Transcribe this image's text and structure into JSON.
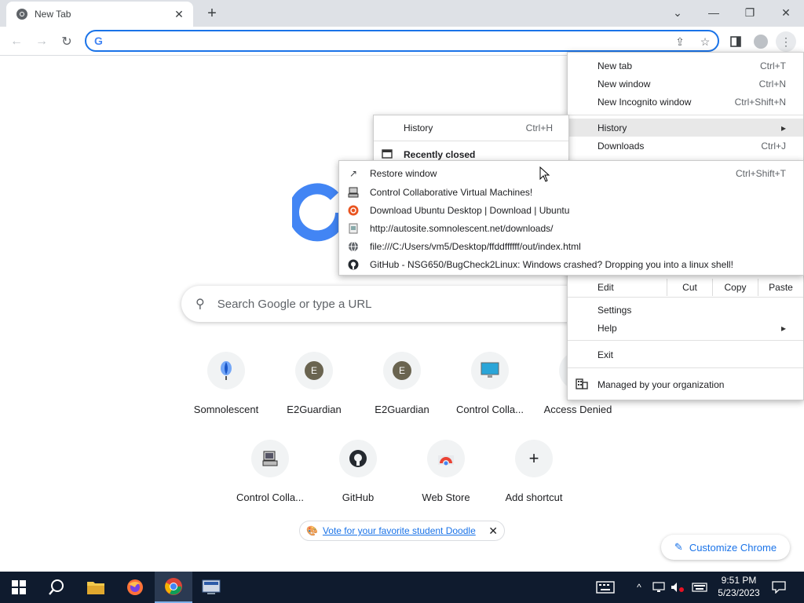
{
  "tab": {
    "title": "New Tab",
    "close": "✕",
    "new_tab": "+"
  },
  "window_controls": {
    "tab_search": "⌄",
    "minimize": "—",
    "restore": "❐",
    "close": "✕"
  },
  "toolbar": {
    "back": "←",
    "forward": "→",
    "reload": "↻",
    "omnibox_value": "",
    "omnibox_g": "G"
  },
  "search": {
    "placeholder": "Search Google or type a URL",
    "icon": "⚲"
  },
  "shortcuts_row1": [
    {
      "label": "Somnolescent",
      "icon": "balloon-icon"
    },
    {
      "label": "E2Guardian",
      "letter": "E"
    },
    {
      "label": "E2Guardian",
      "letter": "E"
    },
    {
      "label": "Control Colla...",
      "icon": "monitor-icon"
    },
    {
      "label": "Access Denied",
      "letter": ""
    }
  ],
  "shortcuts_row2": [
    {
      "label": "Control Colla...",
      "icon": "computer-icon"
    },
    {
      "label": "GitHub",
      "icon": "github-icon"
    },
    {
      "label": "Web Store",
      "icon": "webstore-icon"
    },
    {
      "label": "Add shortcut",
      "glyph": "+"
    }
  ],
  "doodle": {
    "text": "Vote for your favorite student Doodle",
    "close": "✕"
  },
  "customize": {
    "label": "Customize Chrome",
    "icon": "✎"
  },
  "menu": {
    "new_tab": {
      "label": "New tab",
      "shortcut": "Ctrl+T"
    },
    "new_window": {
      "label": "New window",
      "shortcut": "Ctrl+N"
    },
    "new_incognito": {
      "label": "New Incognito window",
      "shortcut": "Ctrl+Shift+N"
    },
    "history": {
      "label": "History",
      "arrow": "▸"
    },
    "downloads": {
      "label": "Downloads",
      "shortcut": "Ctrl+J"
    },
    "edit": {
      "label": "Edit",
      "cut": "Cut",
      "copy": "Copy",
      "paste": "Paste"
    },
    "settings": {
      "label": "Settings"
    },
    "help": {
      "label": "Help",
      "arrow": "▸"
    },
    "exit": {
      "label": "Exit"
    },
    "managed": {
      "label": "Managed by your organization"
    }
  },
  "history_submenu": {
    "history": {
      "label": "History",
      "shortcut": "Ctrl+H"
    },
    "recently_closed": {
      "label": "Recently closed"
    }
  },
  "recently_closed": [
    {
      "label": "Restore window",
      "shortcut": "Ctrl+Shift+T",
      "icon": "open-window-icon"
    },
    {
      "label": "Control Collaborative Virtual Machines!",
      "shortcut": "",
      "icon": "computer-icon"
    },
    {
      "label": "Download Ubuntu Desktop | Download | Ubuntu",
      "shortcut": "",
      "icon": "ubuntu-icon"
    },
    {
      "label": "http://autosite.somnolescent.net/downloads/",
      "shortcut": "",
      "icon": "page-icon"
    },
    {
      "label": "file:///C:/Users/vm5/Desktop/ffddffffff/out/index.html",
      "shortcut": "",
      "icon": "globe-icon"
    },
    {
      "label": "GitHub - NSG650/BugCheck2Linux: Windows crashed? Dropping you into a linux shell!",
      "shortcut": "",
      "icon": "github-icon"
    }
  ],
  "taskbar": {
    "time": "9:51 PM",
    "date": "5/23/2023"
  }
}
